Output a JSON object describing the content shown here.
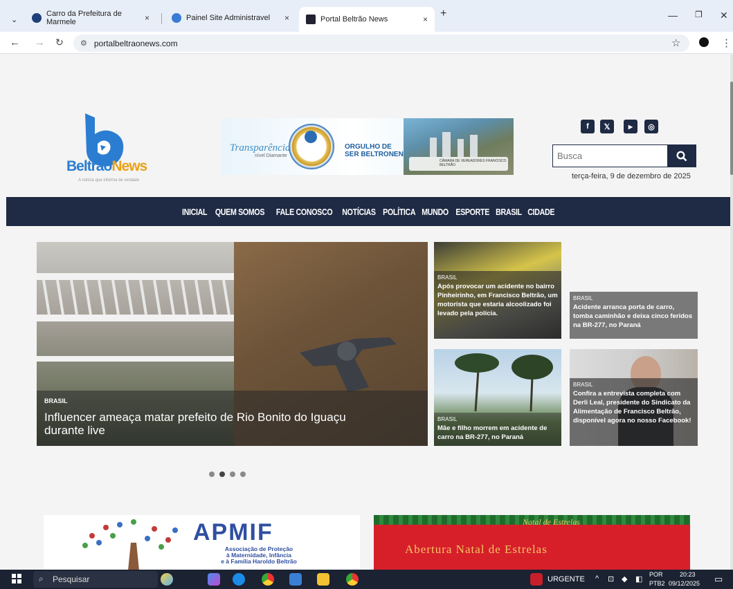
{
  "browser": {
    "tabs": [
      {
        "label": "Carro da Prefeitura de Marmele",
        "close": "×"
      },
      {
        "label": "Painel Site Administravel",
        "close": "×"
      },
      {
        "label": "Portal Beltrão News",
        "close": "×"
      }
    ],
    "new_tab": "+",
    "url": "portalbeltraonews.com"
  },
  "site": {
    "logo_part1": "Beltrão",
    "logo_part2": "News",
    "logo_tagline": "A notícia que informa de verdade",
    "banner": {
      "transparency": "Transparência",
      "level": "nível Diamante",
      "slogan_line1": "ORGULHO DE",
      "slogan_line2": "SER BELTRONENSE.",
      "chamber": "CÂMARA DE VEREADORES FRANCISCO BELTRÃO"
    },
    "search_placeholder": "Busca",
    "date": "terça-feira, 9 de dezembro de 2025"
  },
  "menu": [
    "INICIAL",
    "QUEM SOMOS",
    "FALE CONOSCO",
    "NOTÍCIAS",
    "POLÍTICA",
    "MUNDO",
    "ESPORTE",
    "BRASIL",
    "CIDADE"
  ],
  "featured": {
    "category": "BRASIL",
    "title": "Influencer ameaça matar prefeito de Rio Bonito do Iguaçu durante live"
  },
  "cards": [
    {
      "category": "BRASIL",
      "title": "Após provocar um acidente no bairro Pinheirinho, em Francisco Beltrão, um motorista que estaria alcoolizado foi levado pela polícia."
    },
    {
      "category": "BRASIL",
      "title": "Acidente arranca porta de carro, tomba caminhão e deixa cinco feridos na BR-277, no Paraná"
    },
    {
      "category": "BRASIL",
      "title": "Mãe e filho morrem em acidente de carro na BR-277, no Paraná"
    },
    {
      "category": "BRASIL",
      "title": "Confira a entrevista completa com Derli Leal, presidente do Sindicato da Alimentação de Francisco Beltrão, disponível agora no nosso Facebook!"
    }
  ],
  "ads": {
    "apmif_title": "APMIF",
    "apmif_sub1": "Associação de Proteção",
    "apmif_sub2": "à Maternidade, Infância",
    "apmif_sub3": "e à Família Haroldo Beltrão",
    "natal_small": "Natal de Estrelas",
    "natal_big": "Abertura Natal de Estrelas"
  },
  "taskbar": {
    "search": "Pesquisar",
    "news": "URGENTE",
    "lang1": "POR",
    "lang2": "PTB2",
    "time": "20:23",
    "date": "09/12/2025"
  }
}
